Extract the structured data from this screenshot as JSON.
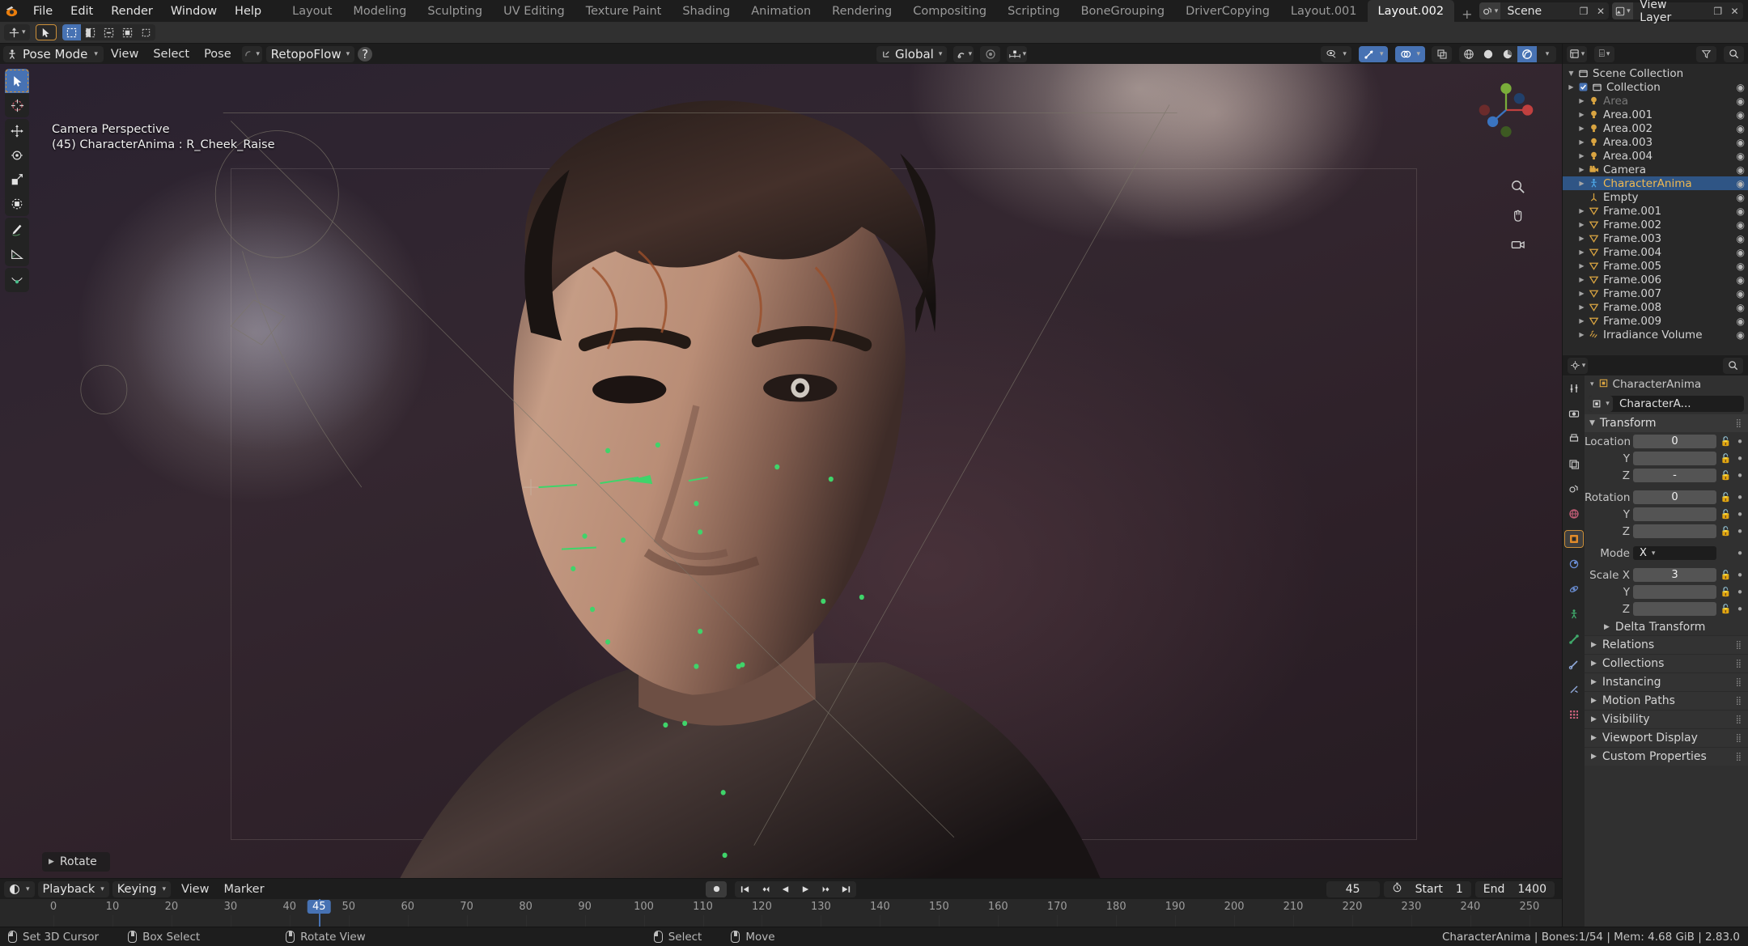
{
  "app": {
    "name": "Blender",
    "version": "2.83.0"
  },
  "topbar": {
    "menus": [
      "File",
      "Edit",
      "Render",
      "Window",
      "Help"
    ],
    "workspaces": [
      {
        "label": "Layout",
        "active": false
      },
      {
        "label": "Modeling",
        "active": false
      },
      {
        "label": "Sculpting",
        "active": false
      },
      {
        "label": "UV Editing",
        "active": false
      },
      {
        "label": "Texture Paint",
        "active": false
      },
      {
        "label": "Shading",
        "active": false
      },
      {
        "label": "Animation",
        "active": false
      },
      {
        "label": "Rendering",
        "active": false
      },
      {
        "label": "Compositing",
        "active": false
      },
      {
        "label": "Scripting",
        "active": false
      },
      {
        "label": "BoneGrouping",
        "active": false
      },
      {
        "label": "DriverCopying",
        "active": false
      },
      {
        "label": "Layout.001",
        "active": false
      },
      {
        "label": "Layout.002",
        "active": true
      }
    ],
    "add_workspace": "+",
    "scene": {
      "label": "Scene"
    },
    "view_layer": {
      "label": "View Layer"
    }
  },
  "viewport_header": {
    "mode": "Pose Mode",
    "menus": [
      "View",
      "Select",
      "Pose"
    ],
    "addon": "RetopoFlow",
    "transform_orientation": "Global"
  },
  "viewport": {
    "info_line1": "Camera Perspective",
    "info_line2": "(45) CharacterAnima : R_Cheek_Raise",
    "redo_panel": "Rotate"
  },
  "toolbar": {
    "tools": [
      "tweak-select-tool",
      "cursor-tool",
      "move-tool",
      "rotate-tool",
      "scale-tool",
      "transform-tool",
      "annotate-tool",
      "measure-tool",
      "bone-tool"
    ]
  },
  "timeline": {
    "menus": [
      "View",
      "Marker"
    ],
    "dropdowns": [
      "Playback",
      "Keying"
    ],
    "playback_buttons": [
      "record-button",
      "jump-to-start-button",
      "previous-keyframe-button",
      "play-reverse-button",
      "play-button",
      "next-keyframe-button",
      "jump-to-end-button"
    ],
    "current_frame": "45",
    "start_label": "Start",
    "start_value": "1",
    "end_label": "End",
    "end_value": "1400",
    "ticks": [
      "0",
      "10",
      "20",
      "30",
      "40",
      "50",
      "60",
      "70",
      "80",
      "90",
      "100",
      "110",
      "120",
      "130",
      "140",
      "150",
      "160",
      "170",
      "180",
      "190",
      "200",
      "210",
      "220",
      "230",
      "240",
      "250"
    ]
  },
  "outliner": {
    "title": "Scene Collection",
    "rows": [
      {
        "label": "Collection",
        "icon": "collection-icon",
        "depth": 1,
        "checkbox": true,
        "selected": false,
        "dim": false
      },
      {
        "label": "Area",
        "icon": "light-icon",
        "depth": 2,
        "selected": false,
        "dim": true
      },
      {
        "label": "Area.001",
        "icon": "light-icon",
        "depth": 2,
        "selected": false,
        "dim": false
      },
      {
        "label": "Area.002",
        "icon": "light-icon",
        "depth": 2,
        "selected": false,
        "dim": false
      },
      {
        "label": "Area.003",
        "icon": "light-icon",
        "depth": 2,
        "selected": false,
        "dim": false
      },
      {
        "label": "Area.004",
        "icon": "light-icon",
        "depth": 2,
        "selected": false,
        "dim": false
      },
      {
        "label": "Camera",
        "icon": "camera-icon",
        "depth": 2,
        "selected": false,
        "dim": false
      },
      {
        "label": "CharacterAnima",
        "icon": "armature-icon",
        "depth": 2,
        "selected": true,
        "dim": false
      },
      {
        "label": "Empty",
        "icon": "empty-icon",
        "depth": 2,
        "selected": false,
        "dim": false,
        "noarrow": true
      },
      {
        "label": "Frame.001",
        "icon": "mesh-cone-icon",
        "depth": 2,
        "selected": false,
        "dim": false
      },
      {
        "label": "Frame.002",
        "icon": "mesh-cone-icon",
        "depth": 2,
        "selected": false,
        "dim": false
      },
      {
        "label": "Frame.003",
        "icon": "mesh-cone-icon",
        "depth": 2,
        "selected": false,
        "dim": false
      },
      {
        "label": "Frame.004",
        "icon": "mesh-cone-icon",
        "depth": 2,
        "selected": false,
        "dim": false
      },
      {
        "label": "Frame.005",
        "icon": "mesh-cone-icon",
        "depth": 2,
        "selected": false,
        "dim": false
      },
      {
        "label": "Frame.006",
        "icon": "mesh-cone-icon",
        "depth": 2,
        "selected": false,
        "dim": false
      },
      {
        "label": "Frame.007",
        "icon": "mesh-cone-icon",
        "depth": 2,
        "selected": false,
        "dim": false
      },
      {
        "label": "Frame.008",
        "icon": "mesh-cone-icon",
        "depth": 2,
        "selected": false,
        "dim": false
      },
      {
        "label": "Frame.009",
        "icon": "mesh-cone-icon",
        "depth": 2,
        "selected": false,
        "dim": false
      },
      {
        "label": "Irradiance Volume",
        "icon": "irradiance-icon",
        "depth": 2,
        "selected": false,
        "dim": false
      }
    ]
  },
  "properties": {
    "breadcrumb_object": "CharacterAnima",
    "id_name": "CharacterA...",
    "transform": {
      "title": "Transform",
      "location_label": "Location X",
      "location": [
        "0",
        "",
        "-"
      ],
      "rotation_label": "Rotation X",
      "rotation": [
        "0",
        "",
        ""
      ],
      "mode_label": "Mode",
      "mode_value": "X",
      "scale_label": "Scale X",
      "scale": [
        "3",
        "",
        ""
      ],
      "axis_y": "Y",
      "axis_z": "Z",
      "delta_transform": "Delta Transform"
    },
    "panels": [
      "Relations",
      "Collections",
      "Instancing",
      "Motion Paths",
      "Visibility",
      "Viewport Display",
      "Custom Properties"
    ],
    "tabs": [
      "tool-tab",
      "render-tab",
      "output-tab",
      "view-layer-tab",
      "scene-tab",
      "world-tab",
      "object-tab",
      "modifier-tab",
      "physics-tab",
      "object-constraints-tab",
      "armature-data-tab",
      "bone-tab",
      "bone-constraint-tab",
      "texture-tab"
    ]
  },
  "statusbar": {
    "hints": [
      {
        "icon": "mouse-left-icon",
        "label": "Set 3D Cursor"
      },
      {
        "icon": "mouse-middle-icon",
        "label": "Box Select"
      },
      {
        "icon": "mouse-left-icon",
        "label": "Rotate View"
      },
      {
        "icon": "mouse-left-icon",
        "label": "Select"
      },
      {
        "icon": "mouse-middle-icon",
        "label": "Move"
      }
    ],
    "status": "CharacterAnima | Bones:1/54  | Mem: 4.68 GiB | 2.83.0"
  },
  "colors": {
    "accent_blue": "#4772b3",
    "accent_orange": "#cc8f39",
    "panel_bg": "#303030",
    "header_bg": "#1d1d1d"
  }
}
